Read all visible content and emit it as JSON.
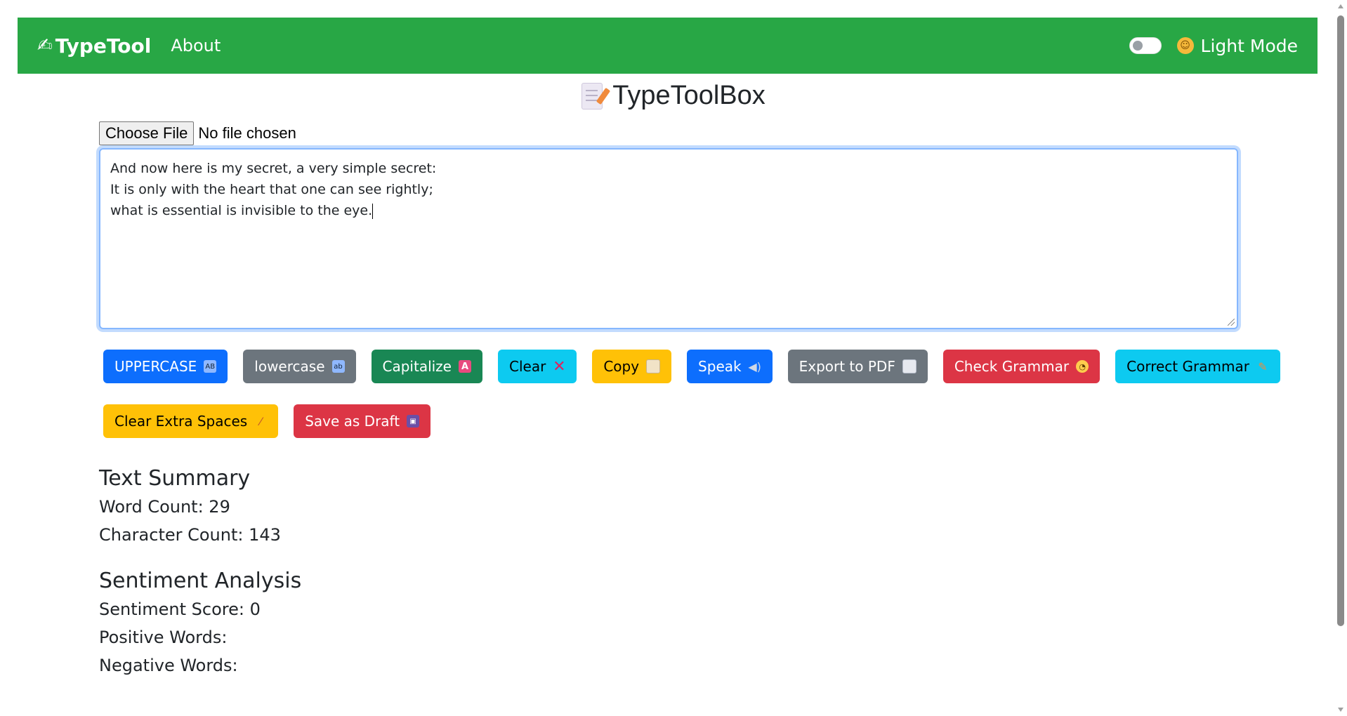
{
  "navbar": {
    "brand": "TypeTool",
    "brand_icon": "writing-hand-icon",
    "about": "About",
    "mode_label": "Light Mode",
    "mode_icon": "smiley-icon",
    "toggle_checked": false,
    "bg_color": "#28a745"
  },
  "title": "TypeToolBox",
  "file_input": {
    "button_label": "Choose File",
    "status": "No file chosen"
  },
  "editor": {
    "lines": [
      "And now here is my secret, a very simple secret:",
      "It is only with the heart that one can see rightly;",
      "what is essential is invisible to the eye."
    ]
  },
  "buttons": {
    "uppercase": "UPPERCASE",
    "lowercase": "lowercase",
    "capitalize": "Capitalize",
    "clear": "Clear",
    "copy": "Copy",
    "speak": "Speak",
    "export_pdf": "Export to PDF",
    "check_grammar": "Check Grammar",
    "correct_grammar": "Correct Grammar",
    "clear_spaces": "Clear Extra Spaces",
    "save_draft": "Save as Draft"
  },
  "summary": {
    "heading": "Text Summary",
    "word_count": "Word Count: 29",
    "char_count": "Character Count: 143"
  },
  "sentiment": {
    "heading": "Sentiment Analysis",
    "score": "Sentiment Score: 0",
    "positive": "Positive Words:",
    "negative": "Negative Words:"
  }
}
